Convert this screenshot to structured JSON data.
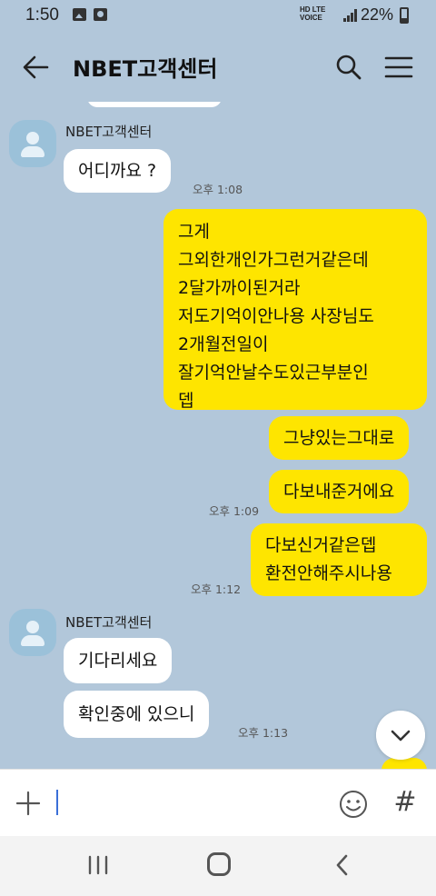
{
  "status_bar": {
    "time": "1:50",
    "network_top": "HD LTE",
    "network_bottom": "VOICE",
    "battery": "22%"
  },
  "header": {
    "title": "NBET고객센터",
    "icons": [
      "back-arrow-icon",
      "search-icon",
      "menu-icon"
    ]
  },
  "messages": [
    {
      "side": "in",
      "sender": "NBET고객센터",
      "text": "어디까요 ?",
      "time": "오후 1:08"
    },
    {
      "side": "out",
      "text": "그게\n그외한개인가그런거같은데\n2달가까이된거라\n저도기억이안나용 사장님도\n2개월전일이\n잘기억안날수도있근부분인\n뎁"
    },
    {
      "side": "out",
      "text": "그냥있는그대로"
    },
    {
      "side": "out",
      "text": "다보내준거에요",
      "time": "오후 1:09"
    },
    {
      "side": "out",
      "text": "다보신거같은뎁\n환전안해주시나용",
      "time": "오후 1:12"
    },
    {
      "side": "in",
      "sender": "NBET고객센터",
      "text": "기다리세요"
    },
    {
      "side": "in",
      "text": "확인중에 있으니",
      "time": "오후 1:13"
    }
  ],
  "input_bar": {
    "placeholder": "",
    "hash_label": "#",
    "icons": [
      "plus-icon",
      "emoji-icon",
      "hash-icon"
    ]
  },
  "scroll_button": {
    "icon": "chevron-down-icon"
  },
  "nav_bar": {
    "icons": [
      "recents-icon",
      "home-icon",
      "back-icon"
    ]
  },
  "colors": {
    "background": "#b2c7da",
    "outgoing_bubble": "#fee500",
    "incoming_bubble": "#ffffff",
    "avatar": "#9bc1d9"
  }
}
